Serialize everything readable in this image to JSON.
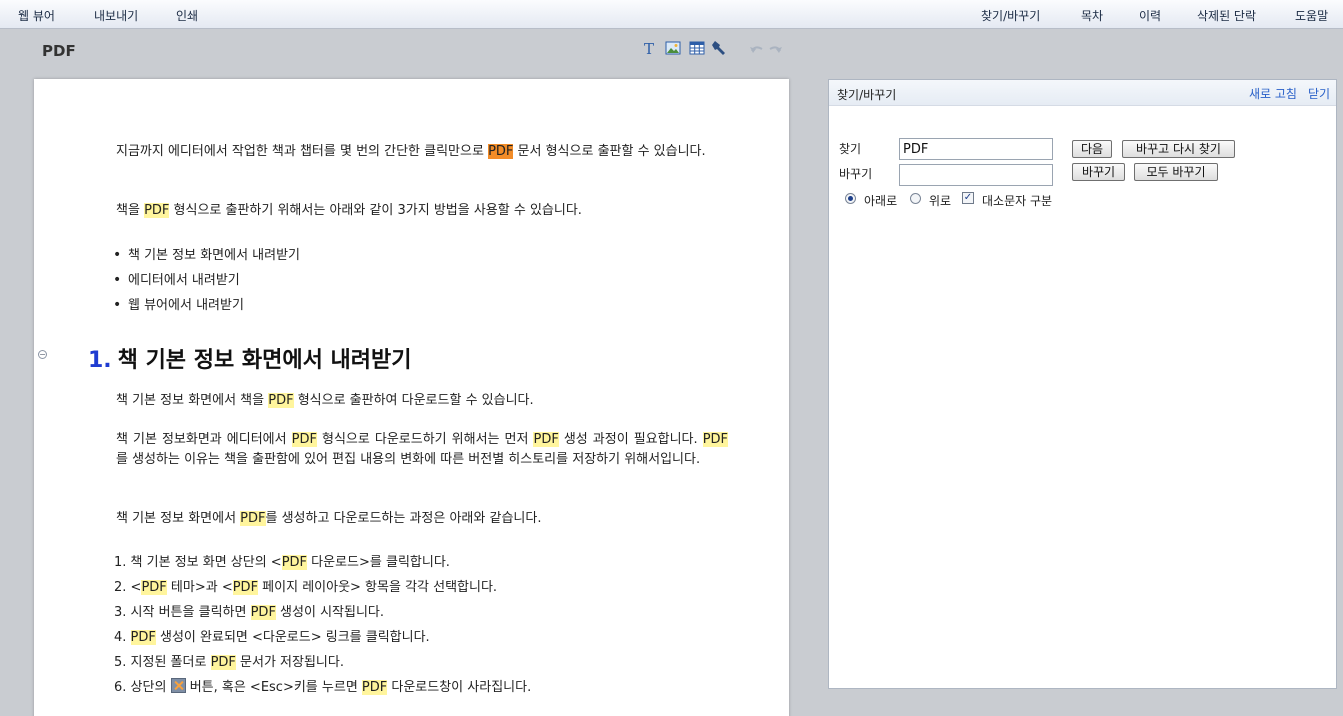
{
  "menu": {
    "left": [
      "웹 뷰어",
      "내보내기",
      "인쇄"
    ],
    "right": [
      "찾기/바꾸기",
      "목차",
      "이력",
      "삭제된 단락",
      "도움말"
    ]
  },
  "toolbar": {
    "doc_title": "PDF",
    "icons": [
      "text-icon",
      "image-icon",
      "table-icon",
      "tools-icon",
      "undo-icon",
      "redo-icon"
    ]
  },
  "document": {
    "intro1_a": "지금까지 에디터에서 작업한 책과 챕터를 몇 번의 간단한 클릭만으로 ",
    "intro1_hl": "PDF",
    "intro1_b": " 문서 형식으로 출판할 수 있습니다.",
    "intro2_a": "책을 ",
    "intro2_hl": "PDF",
    "intro2_b": " 형식으로 출판하기 위해서는 아래와 같이 3가지 방법을 사용할 수 있습니다.",
    "bullets": [
      "책 기본 정보 화면에서 내려받기",
      "에디터에서 내려받기",
      "웹 뷰어에서 내려받기"
    ],
    "heading_num": "1.",
    "heading_text": "책 기본 정보 화면에서 내려받기",
    "p1_a": "책 기본 정보 화면에서 책을 ",
    "p1_hl": "PDF",
    "p1_b": " 형식으로 출판하여 다운로드할 수 있습니다.",
    "p2_a": "책 기본 정보화면과 에디터에서 ",
    "p2_hl1": "PDF",
    "p2_b": " 형식으로 다운로드하기 위해서는 먼저 ",
    "p2_hl2": "PDF",
    "p2_c": " 생성 과정이 필요합니다. ",
    "p2_hl3": "PDF",
    "p2_d": "를 생성하는 이유는 책을 출판함에 있어 편집 내용의 변화에 따른 버전별 히스토리를 저장하기 위해서입니다.",
    "p3_a": "책 기본 정보 화면에서 ",
    "p3_hl": "PDF",
    "p3_b": "를 생성하고 다운로드하는 과정은 아래와 같습니다.",
    "steps": [
      {
        "n": "1.",
        "a": "책 기본 정보 화면 상단의 <",
        "hl": "PDF",
        "b": " 다운로드>를 클릭합니다."
      },
      {
        "n": "2.",
        "a": "<",
        "hl": "PDF",
        "b": " 테마>과 <",
        "hl2": "PDF",
        "c": " 페이지 레이아웃> 항목을 각각 선택합니다."
      },
      {
        "n": "3.",
        "a": "시작 버튼을 클릭하면 ",
        "hl": "PDF",
        "b": " 생성이 시작됩니다."
      },
      {
        "n": "4.",
        "a": "",
        "hl": "PDF",
        "b": " 생성이 완료되면 <다운로드> 링크를 클릭합니다."
      },
      {
        "n": "5.",
        "a": "지정된 폴더로 ",
        "hl": "PDF",
        "b": " 문서가 저장됩니다."
      },
      {
        "n": "6.",
        "a": "상단의 ",
        "b": " 버튼, 혹은 <Esc>키를 누르면 ",
        "hl": "PDF",
        "c": " 다운로드창이 사라집니다."
      }
    ]
  },
  "find_panel": {
    "title": "찾기/바꾸기",
    "refresh": "새로 고침",
    "close": "닫기",
    "find_label": "찾기",
    "find_value": "PDF",
    "replace_label": "바꾸기",
    "replace_value": "",
    "btn_next": "다음",
    "btn_replace_find": "바꾸고 다시 찾기",
    "btn_replace": "바꾸기",
    "btn_replace_all": "모두 바꾸기",
    "dir_down": "아래로",
    "dir_up": "위로",
    "match_case": "대소문자 구분",
    "direction_selected": "아래로",
    "match_case_checked": true
  }
}
